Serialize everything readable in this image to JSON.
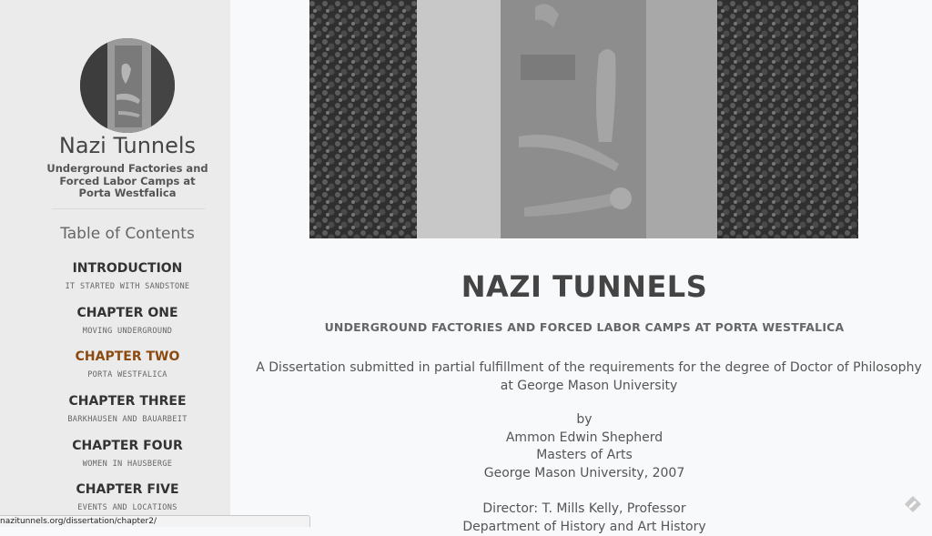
{
  "sidebar": {
    "site_title": "Nazi Tunnels",
    "site_description": "Underground Factories and Forced Labor Camps at Porta Westfalica",
    "toc_heading": "Table of Contents",
    "items": [
      {
        "title": "INTRODUCTION",
        "subtitle": "IT STARTED WITH SANDSTONE"
      },
      {
        "title": "CHAPTER ONE",
        "subtitle": "MOVING UNDERGROUND"
      },
      {
        "title": "CHAPTER TWO",
        "subtitle": "PORTA WESTFALICA"
      },
      {
        "title": "CHAPTER THREE",
        "subtitle": "BARKHAUSEN AND BAUARBEIT"
      },
      {
        "title": "CHAPTER FOUR",
        "subtitle": "WOMEN IN HAUSBERGE"
      },
      {
        "title": "CHAPTER FIVE",
        "subtitle": "EVENTS AND LOCATIONS"
      }
    ],
    "active_item": "CHAPTER TWO",
    "active_color": "#8c4a10"
  },
  "main": {
    "title": "NAZI TUNNELS",
    "subtitle": "UNDERGROUND FACTORIES AND FORCED LABOR CAMPS AT PORTA WESTFALICA",
    "intro": "A Dissertation submitted in partial fulfillment of the requirements for the degree of Doctor of Philosophy at George Mason University",
    "by": "by",
    "author": "Ammon Edwin Shepherd",
    "degree": "Masters of Arts",
    "degree_school": "George Mason University, 2007",
    "director": "Director: T. Mills Kelly, Professor",
    "department": "Department of History and Art History"
  },
  "status_bar": {
    "url": "nazitunnels.org/dissertation/chapter2/"
  },
  "icons": {
    "edit": "edit-pencil-icon"
  }
}
